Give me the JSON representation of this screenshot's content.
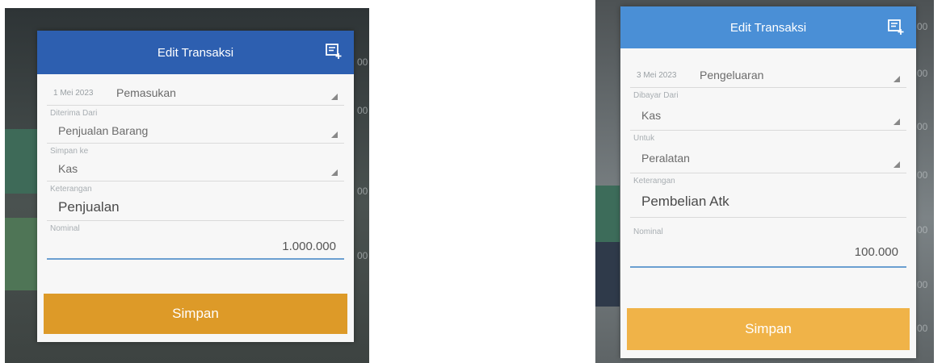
{
  "colors": {
    "header_left": "#2d5fb0",
    "header_right": "#4a8fd6",
    "button_left": "#dd9a28",
    "button_right": "#f0b348",
    "focus_line": "#6b9fd1"
  },
  "left_dialog": {
    "title": "Edit Transaksi",
    "header_icon": "note-add-icon",
    "date": "1 Mei 2023",
    "type": "Pemasukan",
    "source_label": "Diterima Dari",
    "source_value": "Penjualan Barang",
    "dest_label": "Simpan ke",
    "dest_value": "Kas",
    "note_label": "Keterangan",
    "note_value": "Penjualan",
    "amount_label": "Nominal",
    "amount_value": "1.000.000",
    "save_label": "Simpan"
  },
  "right_dialog": {
    "title": "Edit Transaksi",
    "header_icon": "note-add-icon",
    "date": "3 Mei 2023",
    "type": "Pengeluaran",
    "source_label": "Dibayar Dari",
    "source_value": "Kas",
    "dest_label": "Untuk",
    "dest_value": "Peralatan",
    "note_label": "Keterangan",
    "note_value": "Pembelian Atk",
    "amount_label": "Nominal",
    "amount_value": "100.000",
    "save_label": "Simpan"
  },
  "background_left": {
    "fragments": [
      "00",
      "00",
      "00",
      "00"
    ]
  },
  "background_right": {
    "fragments": [
      "00",
      "00",
      "00",
      "00",
      "00",
      "00",
      "00"
    ]
  }
}
